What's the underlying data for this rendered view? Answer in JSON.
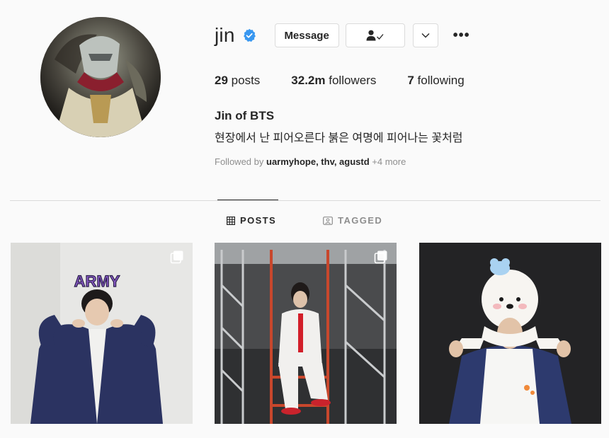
{
  "profile": {
    "username": "jin",
    "verified": true,
    "full_name": "Jin of BTS",
    "bio": "현장에서 난 피어오른다 붉은 여명에 피어나는 꽃처럼",
    "followed_by_prefix": "Followed by",
    "followed_by_users": "uarmyhope, thv, agustd",
    "followed_by_more": "+4 more"
  },
  "actions": {
    "message_label": "Message",
    "more_label": "•••"
  },
  "stats": {
    "posts_count": "29",
    "posts_label": "posts",
    "followers_count": "32.2m",
    "followers_label": "followers",
    "following_count": "7",
    "following_label": "following"
  },
  "tabs": {
    "posts_label": "POSTS",
    "tagged_label": "TAGGED",
    "active": "posts"
  },
  "posts": [
    {
      "sign_text": "ARMY",
      "multiple": true
    },
    {
      "multiple": true
    },
    {
      "multiple": false
    }
  ],
  "colors": {
    "verified_blue": "#3897f0",
    "text_primary": "#262626",
    "text_secondary": "#8e8e8e",
    "border": "#dbdbdb",
    "background": "#fafafa"
  },
  "icons": [
    "verified-badge-icon",
    "person-check-icon",
    "chevron-down-icon",
    "more-options-icon",
    "grid-icon",
    "tag-icon",
    "multiple-posts-icon"
  ]
}
